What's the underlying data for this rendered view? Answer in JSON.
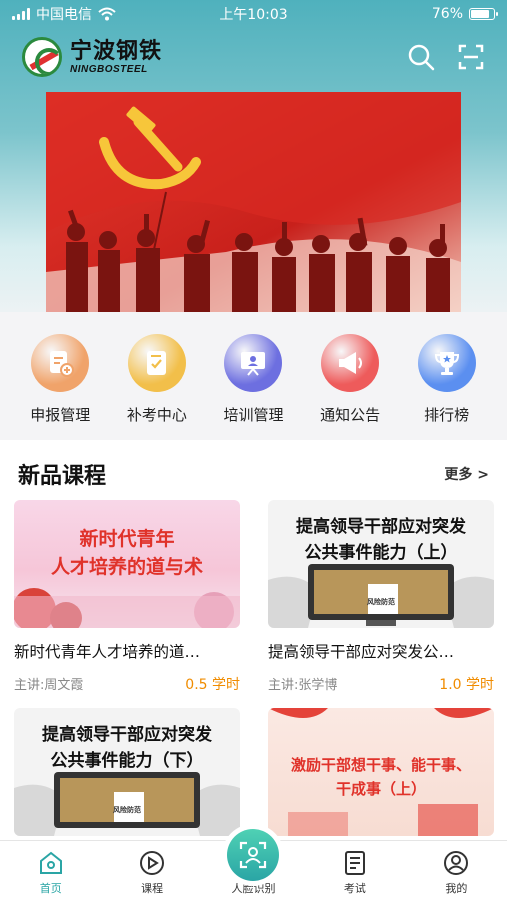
{
  "status": {
    "carrier": "中国电信",
    "time": "上午10:03",
    "battery": "76%",
    "battery_level": 0.76
  },
  "header": {
    "brand_cn": "宁波钢铁",
    "brand_en": "NINGBOSTEEL",
    "icons": [
      "search-icon",
      "scan-icon"
    ]
  },
  "banner": {
    "icon": "party-flag-banner"
  },
  "quick_menu": [
    {
      "label": "申报管理",
      "icon": "application-form-icon",
      "color": "#f0a36a"
    },
    {
      "label": "补考中心",
      "icon": "retake-exam-icon",
      "color": "#f2bf4a"
    },
    {
      "label": "培训管理",
      "icon": "training-board-icon",
      "color": "#6d6fe0"
    },
    {
      "label": "通知公告",
      "icon": "megaphone-icon",
      "color": "#ee5b5b"
    },
    {
      "label": "排行榜",
      "icon": "trophy-icon",
      "color": "#5b8ff0"
    }
  ],
  "section": {
    "title": "新品课程",
    "more": "更多 >"
  },
  "courses": [
    {
      "thumb_text": [
        "新时代青年",
        "人才培养的道与术"
      ],
      "title": "新时代青年人才培养的道…",
      "teacher": "主讲:周文霞",
      "hours": "0.5 学时"
    },
    {
      "thumb_text": [
        "提高领导干部应对突发",
        "公共事件能力（上）"
      ],
      "thumb_sign": "风险防范",
      "title": "提高领导干部应对突发公…",
      "teacher": "主讲:张学博",
      "hours": "1.0 学时"
    },
    {
      "thumb_text": [
        "提高领导干部应对突发",
        "公共事件能力（下）"
      ],
      "thumb_sign": "风险防范"
    },
    {
      "thumb_text": [
        "激励干部想干事、能干事、",
        "干成事（上）"
      ]
    }
  ],
  "tabbar": [
    {
      "label": "首页",
      "icon": "home-icon",
      "active": true
    },
    {
      "label": "课程",
      "icon": "play-circle-icon"
    },
    {
      "label": "人脸识别",
      "icon": "face-scan-icon"
    },
    {
      "label": "考试",
      "icon": "exam-paper-icon"
    },
    {
      "label": "我的",
      "icon": "profile-icon"
    }
  ]
}
